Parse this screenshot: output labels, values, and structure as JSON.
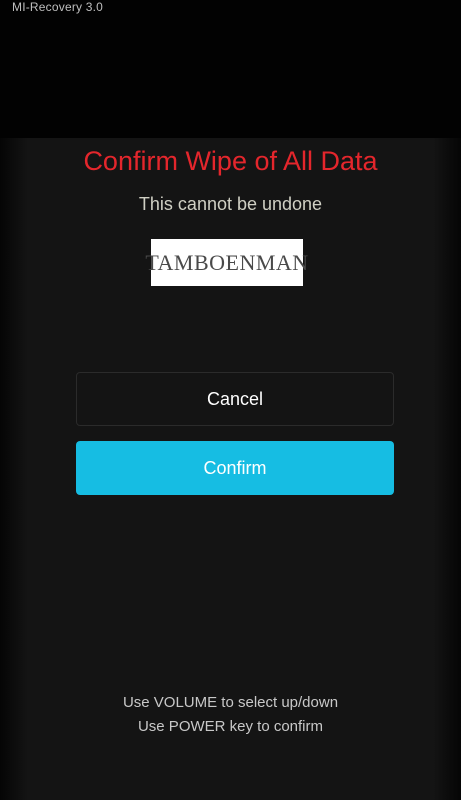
{
  "app_title": "MI-Recovery 3.0",
  "dialog": {
    "title": "Confirm Wipe of All Data",
    "subtitle": "This cannot be undone",
    "watermark_text": "TAMBOENMAN"
  },
  "buttons": {
    "cancel_label": "Cancel",
    "confirm_label": "Confirm"
  },
  "hints": {
    "line1": "Use VOLUME to select up/down",
    "line2": "Use POWER key to confirm"
  },
  "colors": {
    "title": "#e4262c",
    "confirm_button": "#16bde3",
    "background": "#141414"
  }
}
